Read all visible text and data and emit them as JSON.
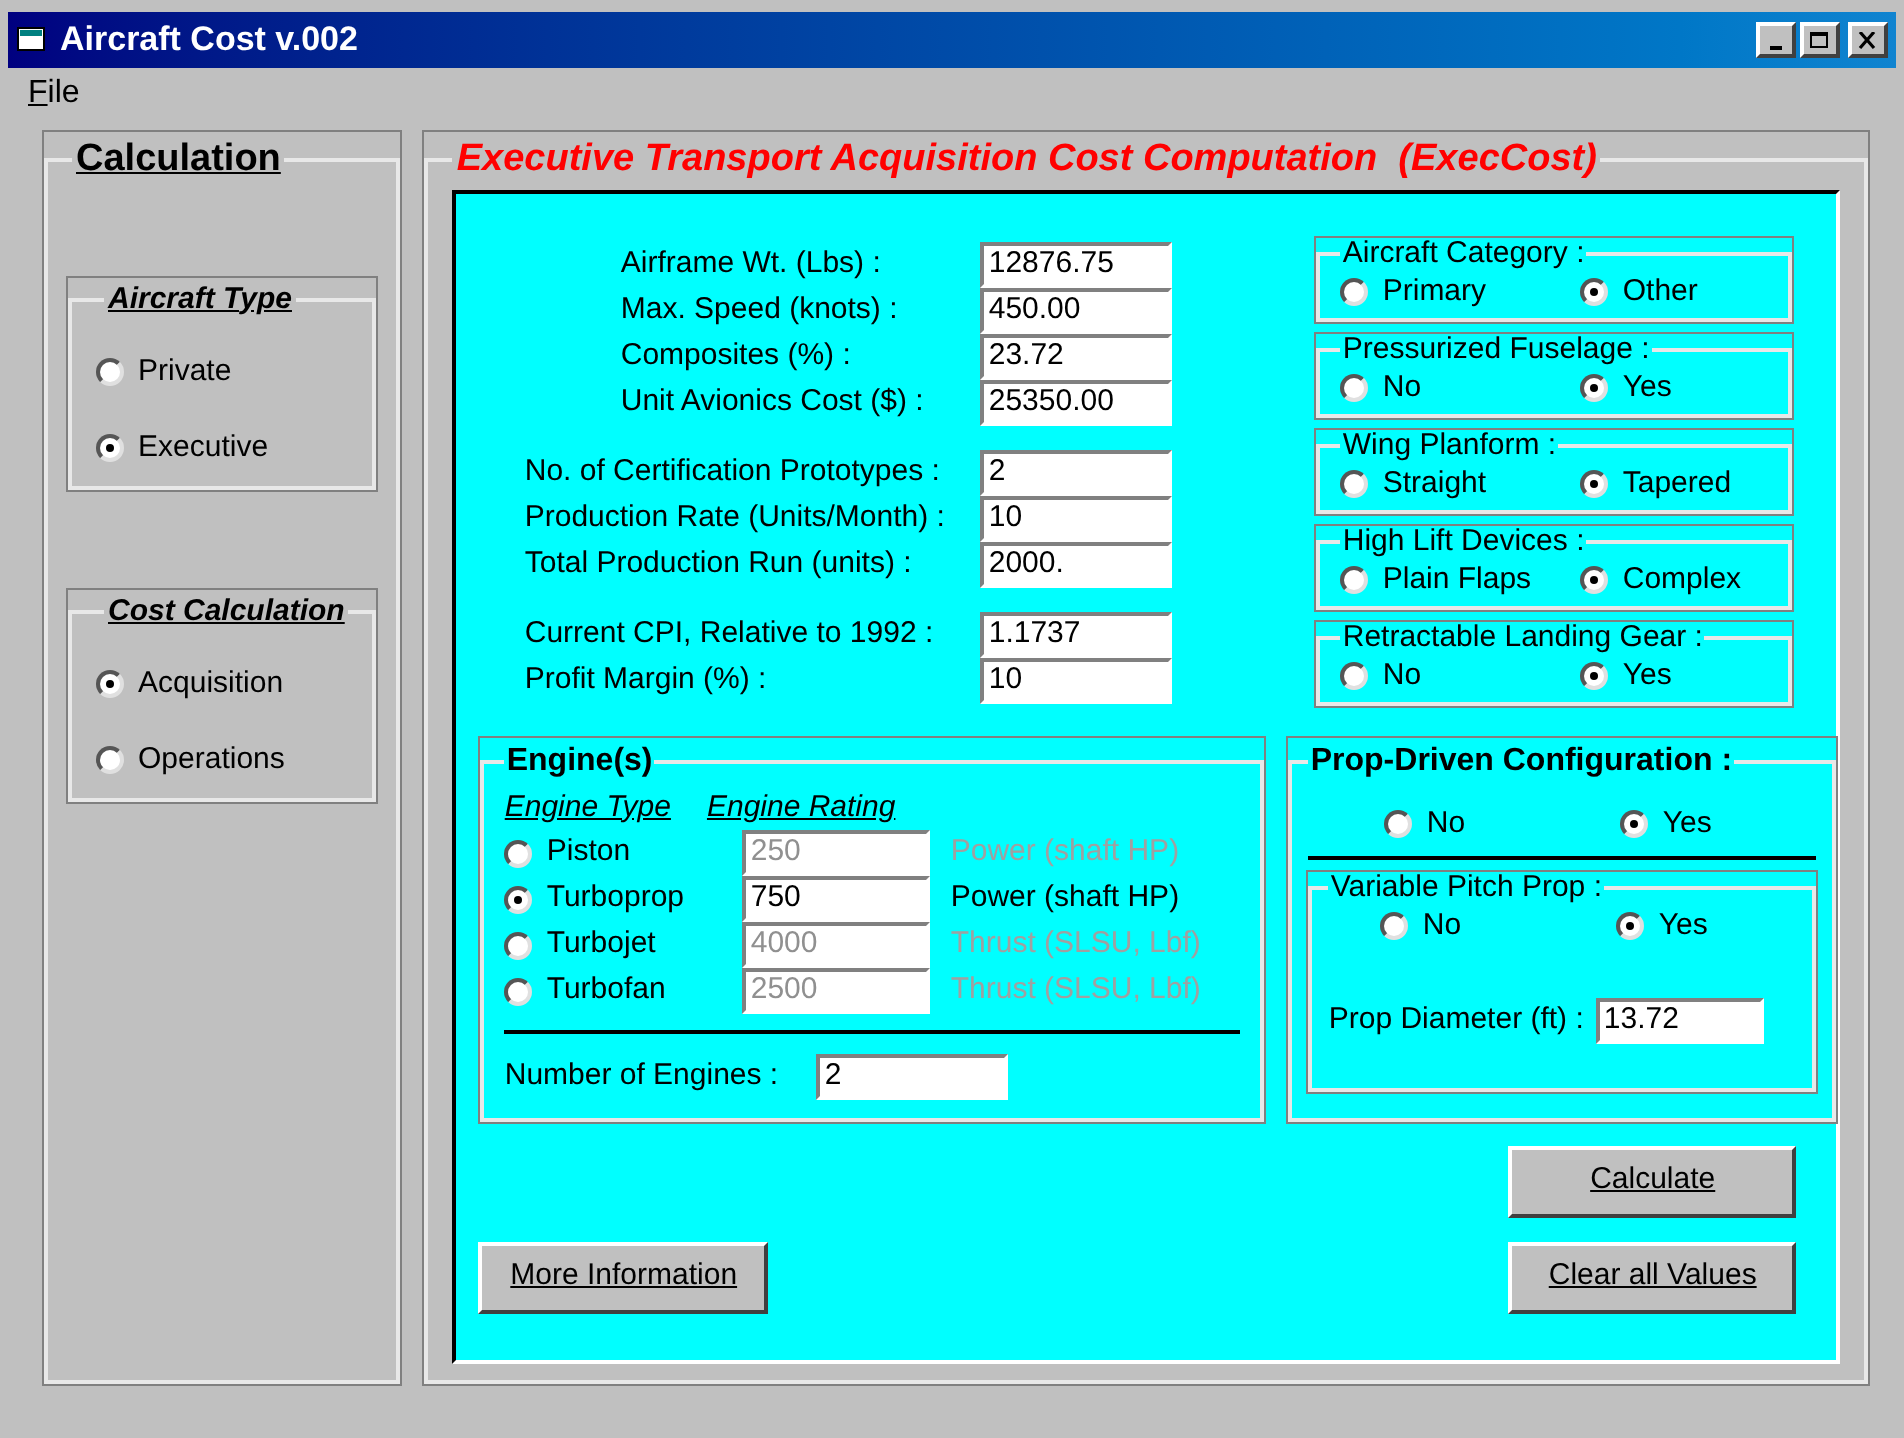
{
  "window": {
    "title": "Aircraft Cost v.002"
  },
  "menu": [
    {
      "label": "File"
    }
  ],
  "calculation": {
    "title": "Calculation",
    "groups": [
      {
        "title": "Aircraft Type",
        "options": [
          {
            "label": "Private",
            "selected": false
          },
          {
            "label": "Executive",
            "selected": true
          }
        ]
      },
      {
        "title": "Cost Calculation",
        "options": [
          {
            "label": "Acquisition",
            "selected": true
          },
          {
            "label": "Operations",
            "selected": false
          }
        ]
      }
    ]
  },
  "main": {
    "title": "Executive Transport Acquisition Cost Computation  (ExecCost)",
    "field_blocks": [
      [
        {
          "label": "Airframe Wt. (Lbs) :",
          "value": "12876.75"
        },
        {
          "label": "Max. Speed (knots) :",
          "value": "450.00"
        },
        {
          "label": "Composites (%) :",
          "value": "23.72"
        },
        {
          "label": "Unit Avionics Cost ($) :",
          "value": "25350.00"
        }
      ],
      [
        {
          "label": "No. of Certification Prototypes :",
          "value": "2"
        },
        {
          "label": "Production Rate (Units/Month) :",
          "value": "10"
        },
        {
          "label": "Total Production Run (units) :",
          "value": "2000."
        }
      ],
      [
        {
          "label": "Current CPI, Relative to 1992 :",
          "value": "1.1737"
        },
        {
          "label": "Profit Margin (%) :",
          "value": "10"
        }
      ]
    ],
    "option_groups": [
      {
        "title": "Aircraft Category :",
        "options": [
          {
            "label": "Primary",
            "selected": false
          },
          {
            "label": "Other",
            "selected": true
          }
        ]
      },
      {
        "title": "Pressurized Fuselage :",
        "options": [
          {
            "label": "No",
            "selected": false
          },
          {
            "label": "Yes",
            "selected": true
          }
        ]
      },
      {
        "title": "Wing Planform :",
        "options": [
          {
            "label": "Straight",
            "selected": false
          },
          {
            "label": "Tapered",
            "selected": true
          }
        ]
      },
      {
        "title": "High Lift Devices :",
        "options": [
          {
            "label": "Plain Flaps",
            "selected": false
          },
          {
            "label": "Complex",
            "selected": true
          }
        ]
      },
      {
        "title": "Retractable Landing Gear :",
        "options": [
          {
            "label": "No",
            "selected": false
          },
          {
            "label": "Yes",
            "selected": true
          }
        ]
      }
    ],
    "engines": {
      "title": "Engine(s)",
      "type_header": "Engine Type",
      "rating_header": "Engine Rating",
      "rows": [
        {
          "type": "Piston",
          "selected": false,
          "value": "250",
          "unit": "Power (shaft HP)",
          "disabled": true
        },
        {
          "type": "Turboprop",
          "selected": true,
          "value": "750",
          "unit": "Power (shaft HP)",
          "disabled": false
        },
        {
          "type": "Turbojet",
          "selected": false,
          "value": "4000",
          "unit": "Thrust (SLSU, Lbf)",
          "disabled": true
        },
        {
          "type": "Turbofan",
          "selected": false,
          "value": "2500",
          "unit": "Thrust (SLSU, Lbf)",
          "disabled": true
        }
      ],
      "count": {
        "label": "Number of Engines :",
        "value": "2"
      }
    },
    "prop": {
      "title": "Prop-Driven Configuration :",
      "options": [
        {
          "label": "No",
          "selected": false
        },
        {
          "label": "Yes",
          "selected": true
        }
      ],
      "variable_pitch": {
        "title": "Variable Pitch Prop :",
        "options": [
          {
            "label": "No",
            "selected": false
          },
          {
            "label": "Yes",
            "selected": true
          }
        ]
      },
      "diameter": {
        "label": "Prop Diameter (ft) :",
        "value": "13.72"
      }
    },
    "buttons": {
      "more_info": "More Information",
      "calculate": "Calculate",
      "clear": "Clear all Values"
    }
  }
}
